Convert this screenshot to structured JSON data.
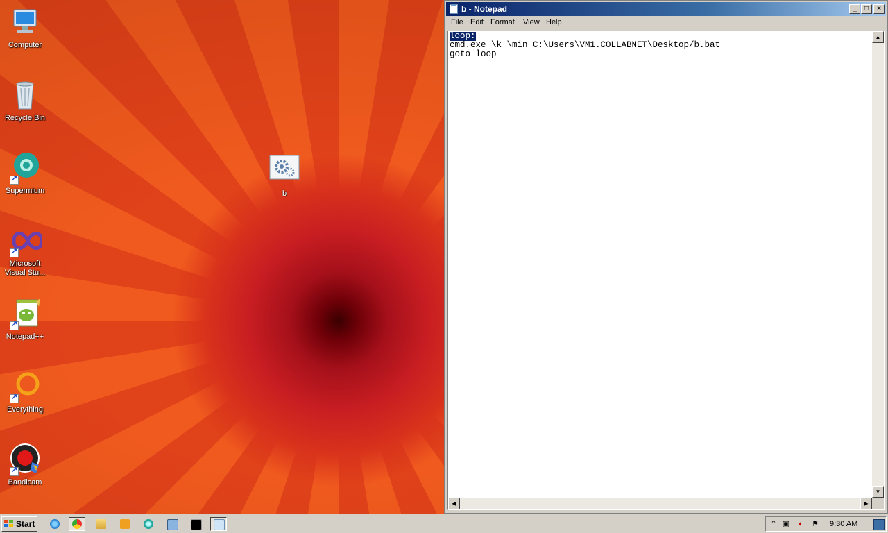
{
  "desktop": {
    "icons": [
      {
        "label": "Computer",
        "icon": "computer-icon"
      },
      {
        "label": "Recycle Bin",
        "icon": "recycle-bin-icon"
      },
      {
        "label": "Supermium",
        "icon": "supermium-icon"
      },
      {
        "label": "Microsoft Visual Stu...",
        "icon": "visual-studio-icon"
      },
      {
        "label": "Notepad++",
        "icon": "notepad-plus-plus-icon"
      },
      {
        "label": "Everything",
        "icon": "everything-icon"
      },
      {
        "label": "Bandicam",
        "icon": "bandicam-icon"
      },
      {
        "label": "b",
        "icon": "batch-file-icon"
      }
    ]
  },
  "notepad": {
    "title": "b - Notepad",
    "menu": [
      "File",
      "Edit",
      "Format",
      "View",
      "Help"
    ],
    "selected_text": "loop:",
    "lines": [
      "loop:",
      "cmd.exe \\k \\min C:\\Users\\VM1.COLLABNET\\Desktop/b.bat",
      "goto loop"
    ],
    "buttons": {
      "minimize": "_",
      "maximize": "□",
      "close": "×"
    }
  },
  "taskbar": {
    "start_label": "Start",
    "quick_launch": [
      "internet-explorer-icon",
      "chrome-icon",
      "explorer-icon",
      "media-player-icon",
      "supermium-icon",
      "remote-desktop-icon",
      "cmd-icon",
      "notepad-icon"
    ],
    "tray_icons": [
      "show-hidden-icon",
      "network-icon",
      "volume-muted-icon",
      "action-center-flag-icon",
      "show-desktop-icon"
    ],
    "clock": "9:30 AM"
  },
  "colors": {
    "titlebar_start": "#0a246a",
    "titlebar_end": "#a6caf0",
    "selection": "#0a246a",
    "wallpaper": "#e84a1a"
  }
}
